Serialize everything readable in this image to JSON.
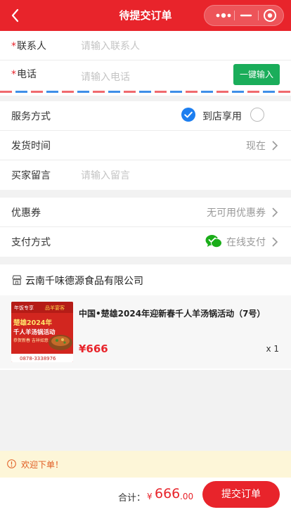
{
  "header": {
    "title": "待提交订单",
    "back_icon": "chevron-left-icon",
    "capsule_icons": [
      "more-icon",
      "minimize-icon",
      "close-circle-icon"
    ],
    "bg_color": "#e8242b"
  },
  "contact": {
    "name_label": "联系人",
    "name_placeholder": "请输入联系人",
    "phone_label": "电话",
    "phone_placeholder": "请输入电话",
    "required_mark": "*",
    "fill_button": "一键输入"
  },
  "delivery": {
    "service_label": "服务方式",
    "service_option_checked": "到店享用",
    "ship_time_label": "发货时间",
    "ship_time_value": "现在",
    "message_label": "买家留言",
    "message_placeholder": "请输入留言"
  },
  "payment": {
    "coupon_label": "优惠券",
    "coupon_value": "无可用优惠券",
    "method_label": "支付方式",
    "method_value": "在线支付",
    "method_icon": "wechat-pay-icon"
  },
  "order": {
    "shop_icon": "store-icon",
    "shop_name": "云南千味德源食品有限公司",
    "product_title": "中国•楚雄2024年迎新春千人羊汤锅活动（7号）",
    "price": "¥666",
    "qty": "x 1",
    "thumb_texts": {
      "top_left": "年饭专享",
      "top_right": "品羊宴客",
      "year": "楚雄2024年",
      "event": "千人羊汤锅活动",
      "sub": "恭贺新春 吉祥如意",
      "phone": "0878-3338976"
    }
  },
  "notice": {
    "icon": "info-circle-icon",
    "text": "欢迎下单！"
  },
  "footer": {
    "total_label": "合计：",
    "currency": "¥",
    "total_integer": "666",
    "total_decimal": ".00",
    "submit_label": "提交订单"
  }
}
